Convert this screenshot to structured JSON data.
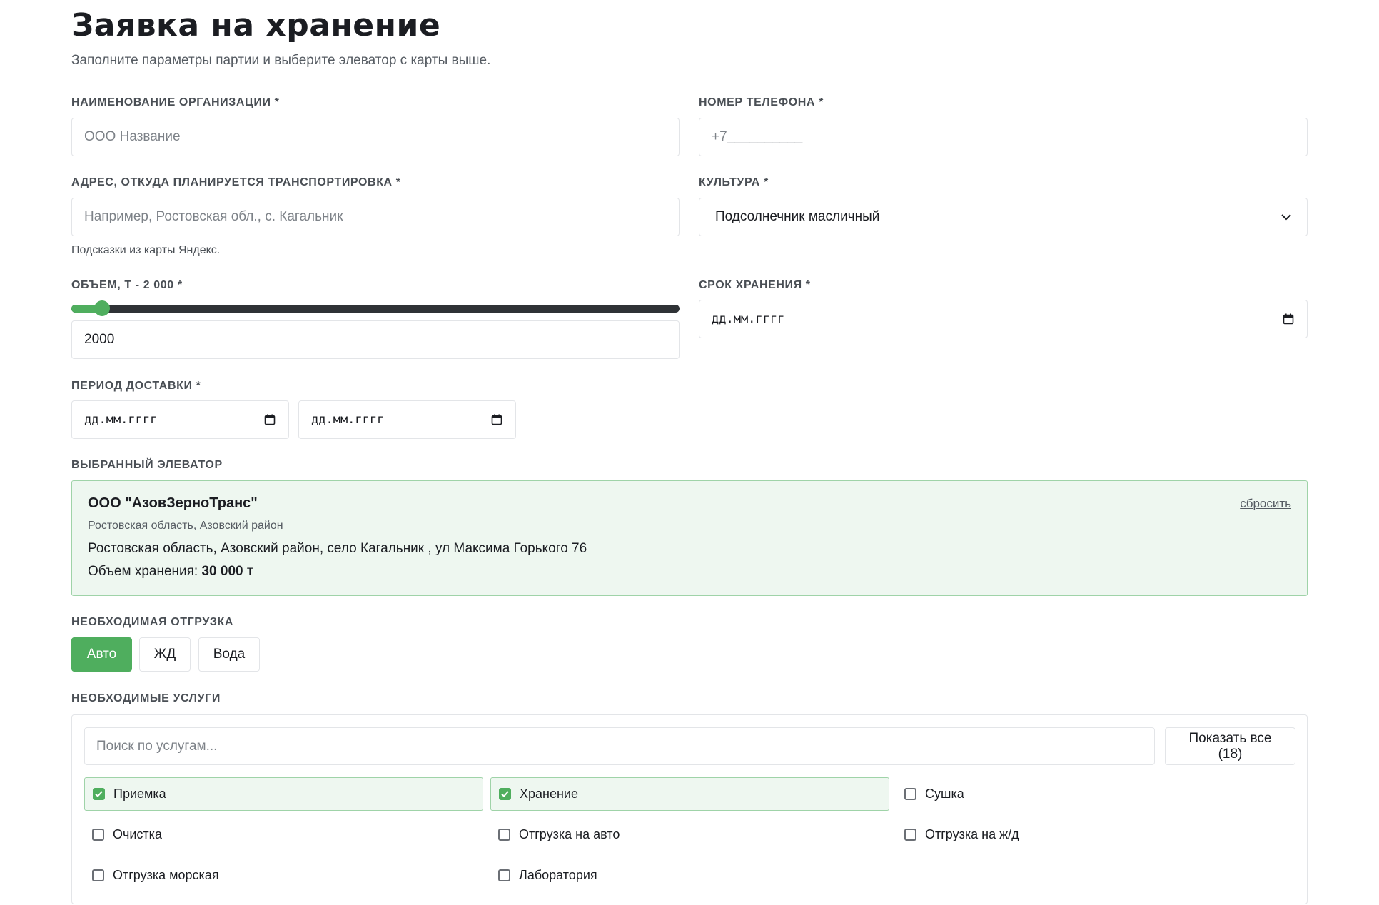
{
  "header": {
    "title": "Заявка на хранение",
    "subtitle": "Заполните параметры партии и выберите элеватор с карты выше."
  },
  "form": {
    "org": {
      "label": "НАИМЕНОВАНИЕ ОРГАНИЗАЦИИ *",
      "placeholder": "ООО Название",
      "value": ""
    },
    "phone": {
      "label": "НОМЕР ТЕЛЕФОНА *",
      "value": "+7__________"
    },
    "address": {
      "label": "АДРЕС, ОТКУДА ПЛАНИРУЕТСЯ ТРАНСПОРТИРОВКА *",
      "placeholder": "Например, Ростовская обл., с. Кагальник",
      "hint": "Подсказки из карты Яндекс."
    },
    "culture": {
      "label": "КУЛЬТУРА *",
      "value": "Подсолнечник масличный",
      "icon": "chevron-down-icon"
    },
    "volume": {
      "label": "ОБЪЕМ, Т - 2 000 *",
      "value": "2000",
      "slider_fraction": 0.05
    },
    "storage_term": {
      "label": "СРОК ХРАНЕНИЯ *",
      "placeholder": "дд.мм.гггг",
      "icon": "calendar-icon"
    },
    "delivery": {
      "label": "ПЕРИОД ДОСТАВКИ *",
      "from_placeholder": "дд.мм.гггг",
      "to_placeholder": "дд.мм.гггг",
      "icon": "calendar-icon"
    }
  },
  "elevator": {
    "label": "ВЫБРАННЫЙ ЭЛЕВАТОР",
    "name": "ООО \"АзовЗерноТранс\"",
    "region": "Ростовская область, Азовский район",
    "address": "Ростовская область, Азовский район, село Кагальник , ул Максима Горького 76",
    "volume_prefix": "Объем хранения:",
    "volume_value": "30 000",
    "volume_unit": "т",
    "reset_label": "сбросить"
  },
  "shipment": {
    "label": "НЕОБХОДИМАЯ ОТГРУЗКА",
    "options": [
      {
        "label": "Авто",
        "active": true
      },
      {
        "label": "ЖД",
        "active": false
      },
      {
        "label": "Вода",
        "active": false
      }
    ]
  },
  "services": {
    "label": "НЕОБХОДИМЫЕ УСЛУГИ",
    "search_placeholder": "Поиск по услугам...",
    "show_all_line1": "Показать все",
    "show_all_line2": "(18)",
    "items": [
      {
        "label": "Приемка",
        "checked": true
      },
      {
        "label": "Хранение",
        "checked": true
      },
      {
        "label": "Сушка",
        "checked": false
      },
      {
        "label": "Очистка",
        "checked": false
      },
      {
        "label": "Отгрузка на авто",
        "checked": false
      },
      {
        "label": "Отгрузка на ж/д",
        "checked": false
      },
      {
        "label": "Отгрузка морская",
        "checked": false
      },
      {
        "label": "Лаборатория",
        "checked": false
      }
    ]
  },
  "colors": {
    "accent": "#4fae5e",
    "accent_bg": "#eef7f0",
    "accent_border": "#9fd3a8"
  }
}
